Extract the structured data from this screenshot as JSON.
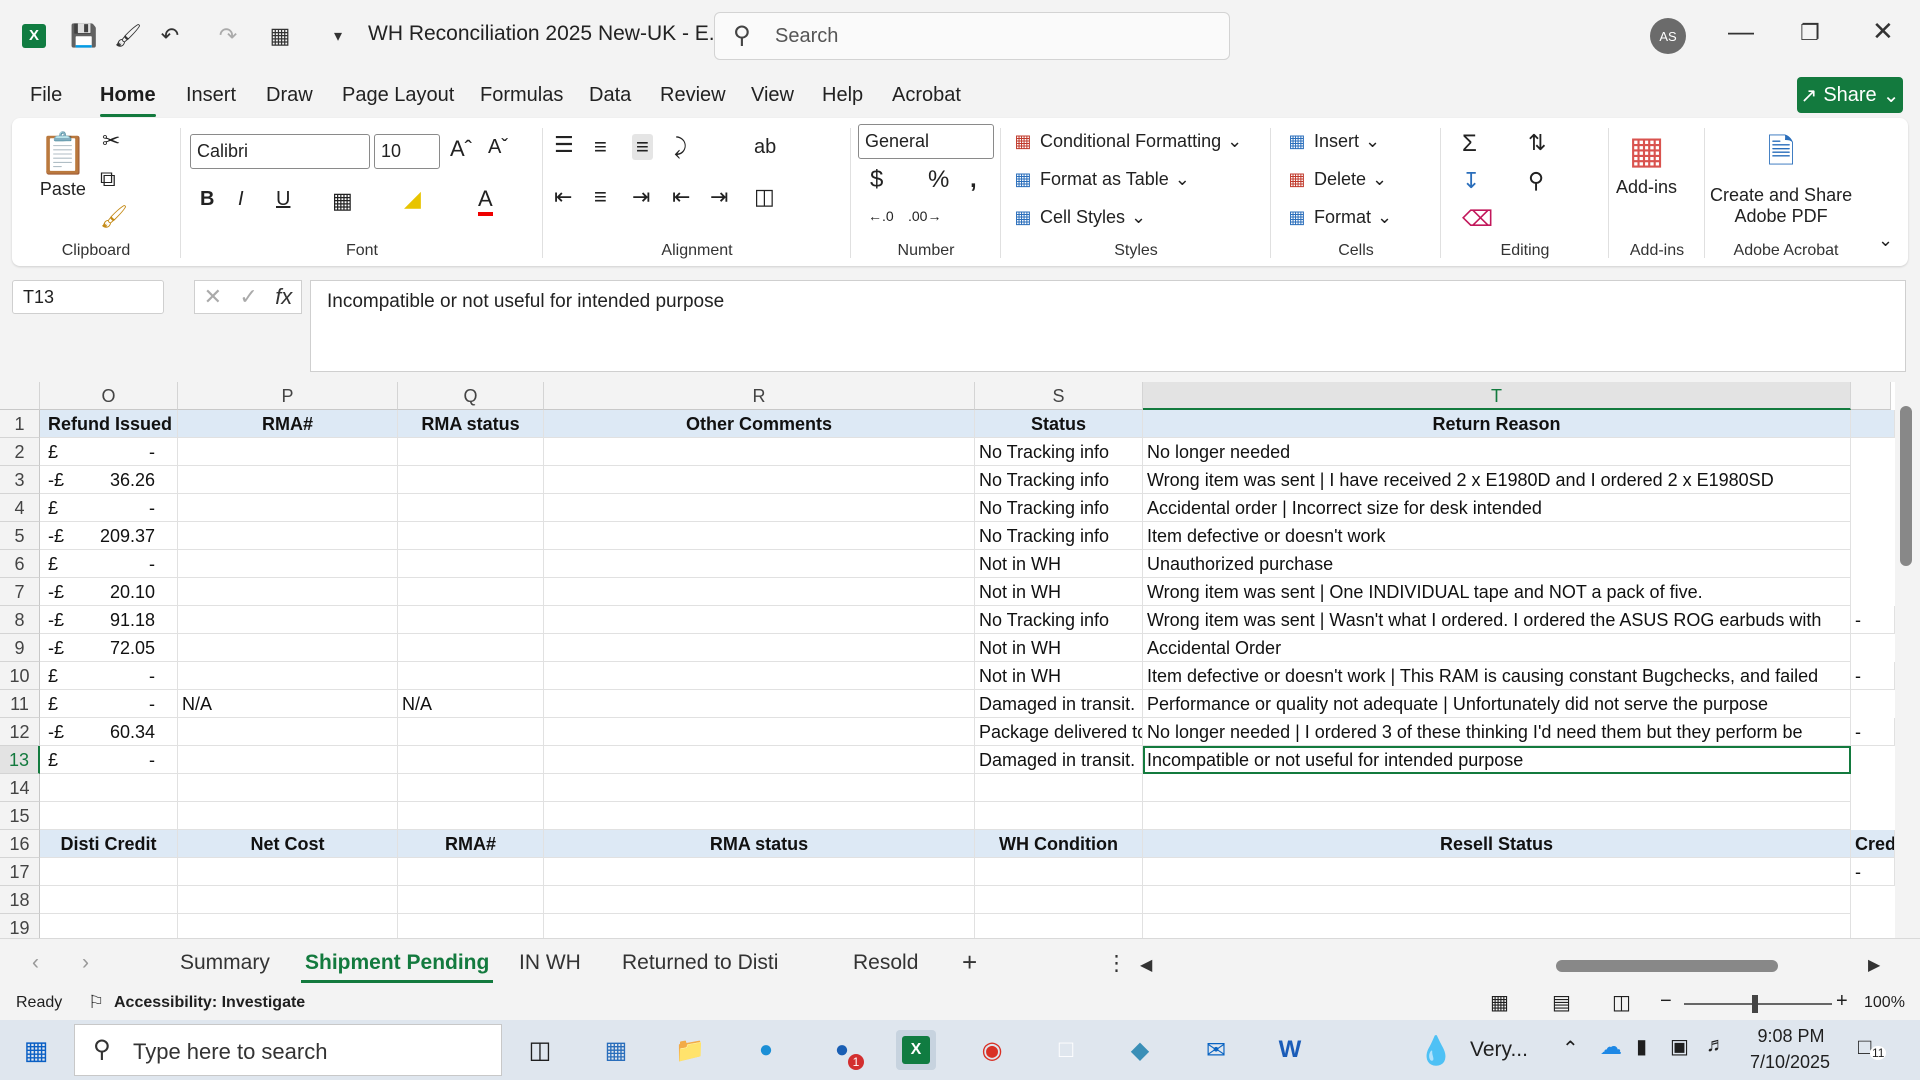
{
  "app": {
    "title": "WH Reconciliation 2025 New-UK  -  E...",
    "search_placeholder": "Search",
    "avatar": "AS"
  },
  "menu": [
    "File",
    "Home",
    "Insert",
    "Draw",
    "Page Layout",
    "Formulas",
    "Data",
    "Review",
    "View",
    "Help",
    "Acrobat"
  ],
  "share_label": "Share",
  "ribbon": {
    "clipboard": {
      "paste": "Paste",
      "label": "Clipboard"
    },
    "font": {
      "name": "Calibri",
      "size": "10",
      "label": "Font"
    },
    "alignment": {
      "label": "Alignment"
    },
    "number": {
      "format": "General",
      "label": "Number"
    },
    "styles": {
      "conditional": "Conditional Formatting",
      "table": "Format as Table",
      "cell": "Cell Styles",
      "label": "Styles"
    },
    "cells": {
      "insert": "Insert",
      "delete": "Delete",
      "format": "Format",
      "label": "Cells"
    },
    "editing": {
      "label": "Editing"
    },
    "addins": {
      "btn": "Add-ins",
      "label": "Add-ins"
    },
    "acrobat": {
      "btn1": "Create and Share",
      "btn2": "Adobe PDF",
      "label": "Adobe Acrobat"
    }
  },
  "formula_bar": {
    "cell_ref": "T13",
    "content": "Incompatible or not useful for intended purpose"
  },
  "columns": [
    "O",
    "P",
    "Q",
    "R",
    "S",
    "T"
  ],
  "rows": [
    "1",
    "2",
    "3",
    "4",
    "5",
    "6",
    "7",
    "8",
    "9",
    "10",
    "11",
    "12",
    "13",
    "14",
    "15",
    "16",
    "17",
    "18",
    "19"
  ],
  "header1": [
    "Refund Issued",
    "RMA#",
    "RMA status",
    "Other Comments",
    "Status",
    "Return Reason"
  ],
  "data": [
    {
      "c": "£",
      "v": "-",
      "p": "",
      "q": "",
      "s": "No Tracking info",
      "t": "No longer needed"
    },
    {
      "c": "-£",
      "v": "36.26",
      "p": "",
      "q": "",
      "s": "No Tracking info",
      "t": "Wrong item was sent | I have received 2 x E1980D and I ordered 2 x E1980SD"
    },
    {
      "c": "£",
      "v": "-",
      "p": "",
      "q": "",
      "s": "No Tracking info",
      "t": "Accidental order | Incorrect size for desk intended"
    },
    {
      "c": "-£",
      "v": "209.37",
      "p": "",
      "q": "",
      "s": "No Tracking info",
      "t": "Item defective or doesn't work"
    },
    {
      "c": "£",
      "v": "-",
      "p": "",
      "q": "",
      "s": "Not in WH",
      "t": "Unauthorized purchase"
    },
    {
      "c": "-£",
      "v": "20.10",
      "p": "",
      "q": "",
      "s": "Not in WH",
      "t": "Wrong item was sent | One INDIVIDUAL tape and NOT a pack of five."
    },
    {
      "c": "-£",
      "v": "91.18",
      "p": "",
      "q": "",
      "s": "No Tracking info",
      "t": "Wrong item was sent | Wasn't what I ordered. I ordered the ASUS ROG earbuds with"
    },
    {
      "c": "-£",
      "v": "72.05",
      "p": "",
      "q": "",
      "s": "Not in WH",
      "t": "Accidental Order"
    },
    {
      "c": "£",
      "v": "-",
      "p": "",
      "q": "",
      "s": "Not in WH",
      "t": "Item defective or doesn't work | This RAM is causing constant Bugchecks, and failed"
    },
    {
      "c": "£",
      "v": "-",
      "p": "N/A",
      "q": "N/A",
      "s": "Damaged in transit.",
      "t": "Performance or quality not adequate | Unfortunately did not serve the purpose"
    },
    {
      "c": "-£",
      "v": "60.34",
      "p": "",
      "q": "",
      "s": "Package delivered to",
      "t": "No longer needed | I ordered 3 of these thinking I'd need them but they perform be"
    },
    {
      "c": "£",
      "v": "-",
      "p": "",
      "q": "",
      "s": "Damaged in transit.",
      "t": "Incompatible or not useful for intended purpose"
    }
  ],
  "overflow_marks": [
    "-",
    "-",
    "-"
  ],
  "header2": [
    "Disti Credit",
    "Net Cost",
    "RMA#",
    "RMA status",
    "WH Condition",
    "Resell Status",
    "Cred"
  ],
  "row17_u": "-",
  "sheets": [
    "Summary",
    "Shipment Pending",
    "IN WH",
    "Returned to Disti",
    "Resold"
  ],
  "status": {
    "ready": "Ready",
    "accessibility": "Accessibility: Investigate",
    "zoom": "100%"
  },
  "taskbar": {
    "search": "Type here to search",
    "weather": "Very...",
    "time": "9:08 PM",
    "date": "7/10/2025",
    "notif": "11",
    "zoom_badge": "1"
  },
  "colors": {
    "accent": "#137a3e",
    "header_fill": "#dde9f5"
  }
}
